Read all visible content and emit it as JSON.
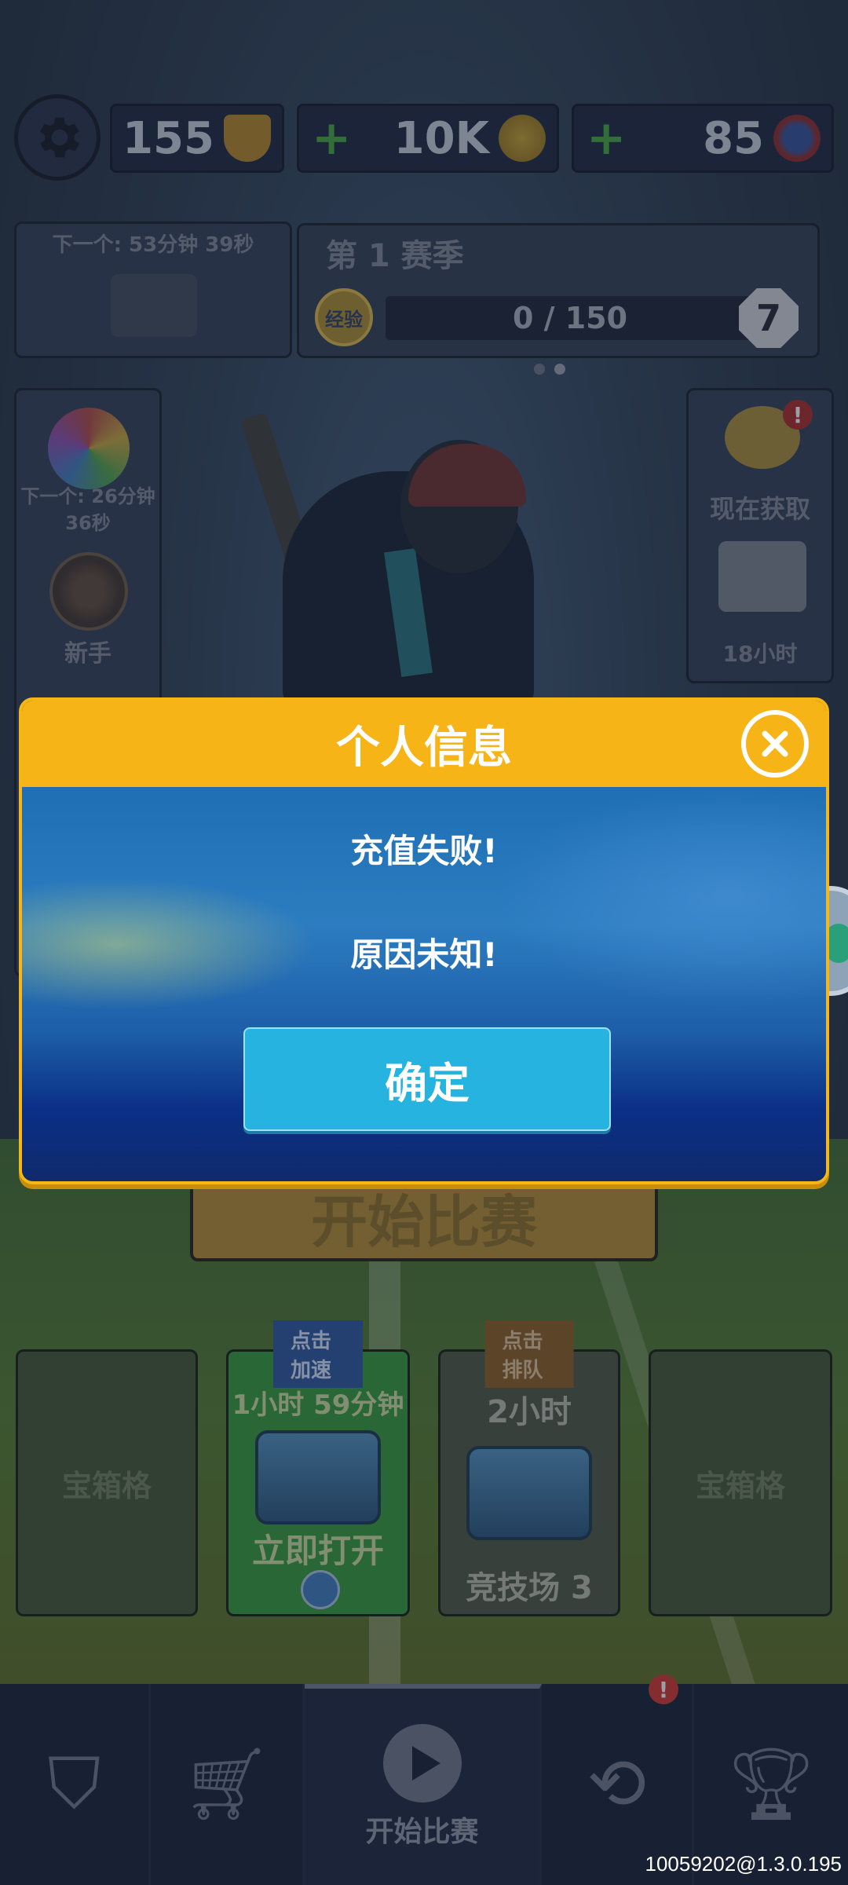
{
  "top_bar": {
    "trophies": "155",
    "coins": "10K",
    "gems": "85",
    "plus": "+"
  },
  "chest_timer_card": {
    "next_label": "下一个: 53分钟 39秒"
  },
  "season_card": {
    "title": "第 1 赛季",
    "xp_label": "经验",
    "progress": "0 / 150",
    "progress_fraction": 0.0,
    "level": "7"
  },
  "left_panel": {
    "spin_timer": "下一个: 26分钟 36秒",
    "beginner_label": "新手"
  },
  "right_panel": {
    "get_now": "现在获取",
    "hours": "18小时"
  },
  "dialog": {
    "title": "个人信息",
    "message_line1": "充值失败!",
    "message_line2": "原因未知!",
    "confirm": "确定"
  },
  "start_match_bg": "开始比赛",
  "chest_slots": [
    {
      "label": "宝箱格"
    },
    {
      "tag": "点击加速",
      "timer": "1小时 59分钟",
      "action": "立即打开"
    },
    {
      "tag": "点击排队",
      "timer": "2小时",
      "arena": "竞技场 3"
    },
    {
      "label": "宝箱格"
    }
  ],
  "nav": {
    "start_label": "开始比赛",
    "badge": "!"
  },
  "version_text": "10059202@1.3.0.195",
  "colors": {
    "dialog_header": "#f6b417",
    "confirm_button": "#27b3e0",
    "badge": "#d4302c"
  }
}
